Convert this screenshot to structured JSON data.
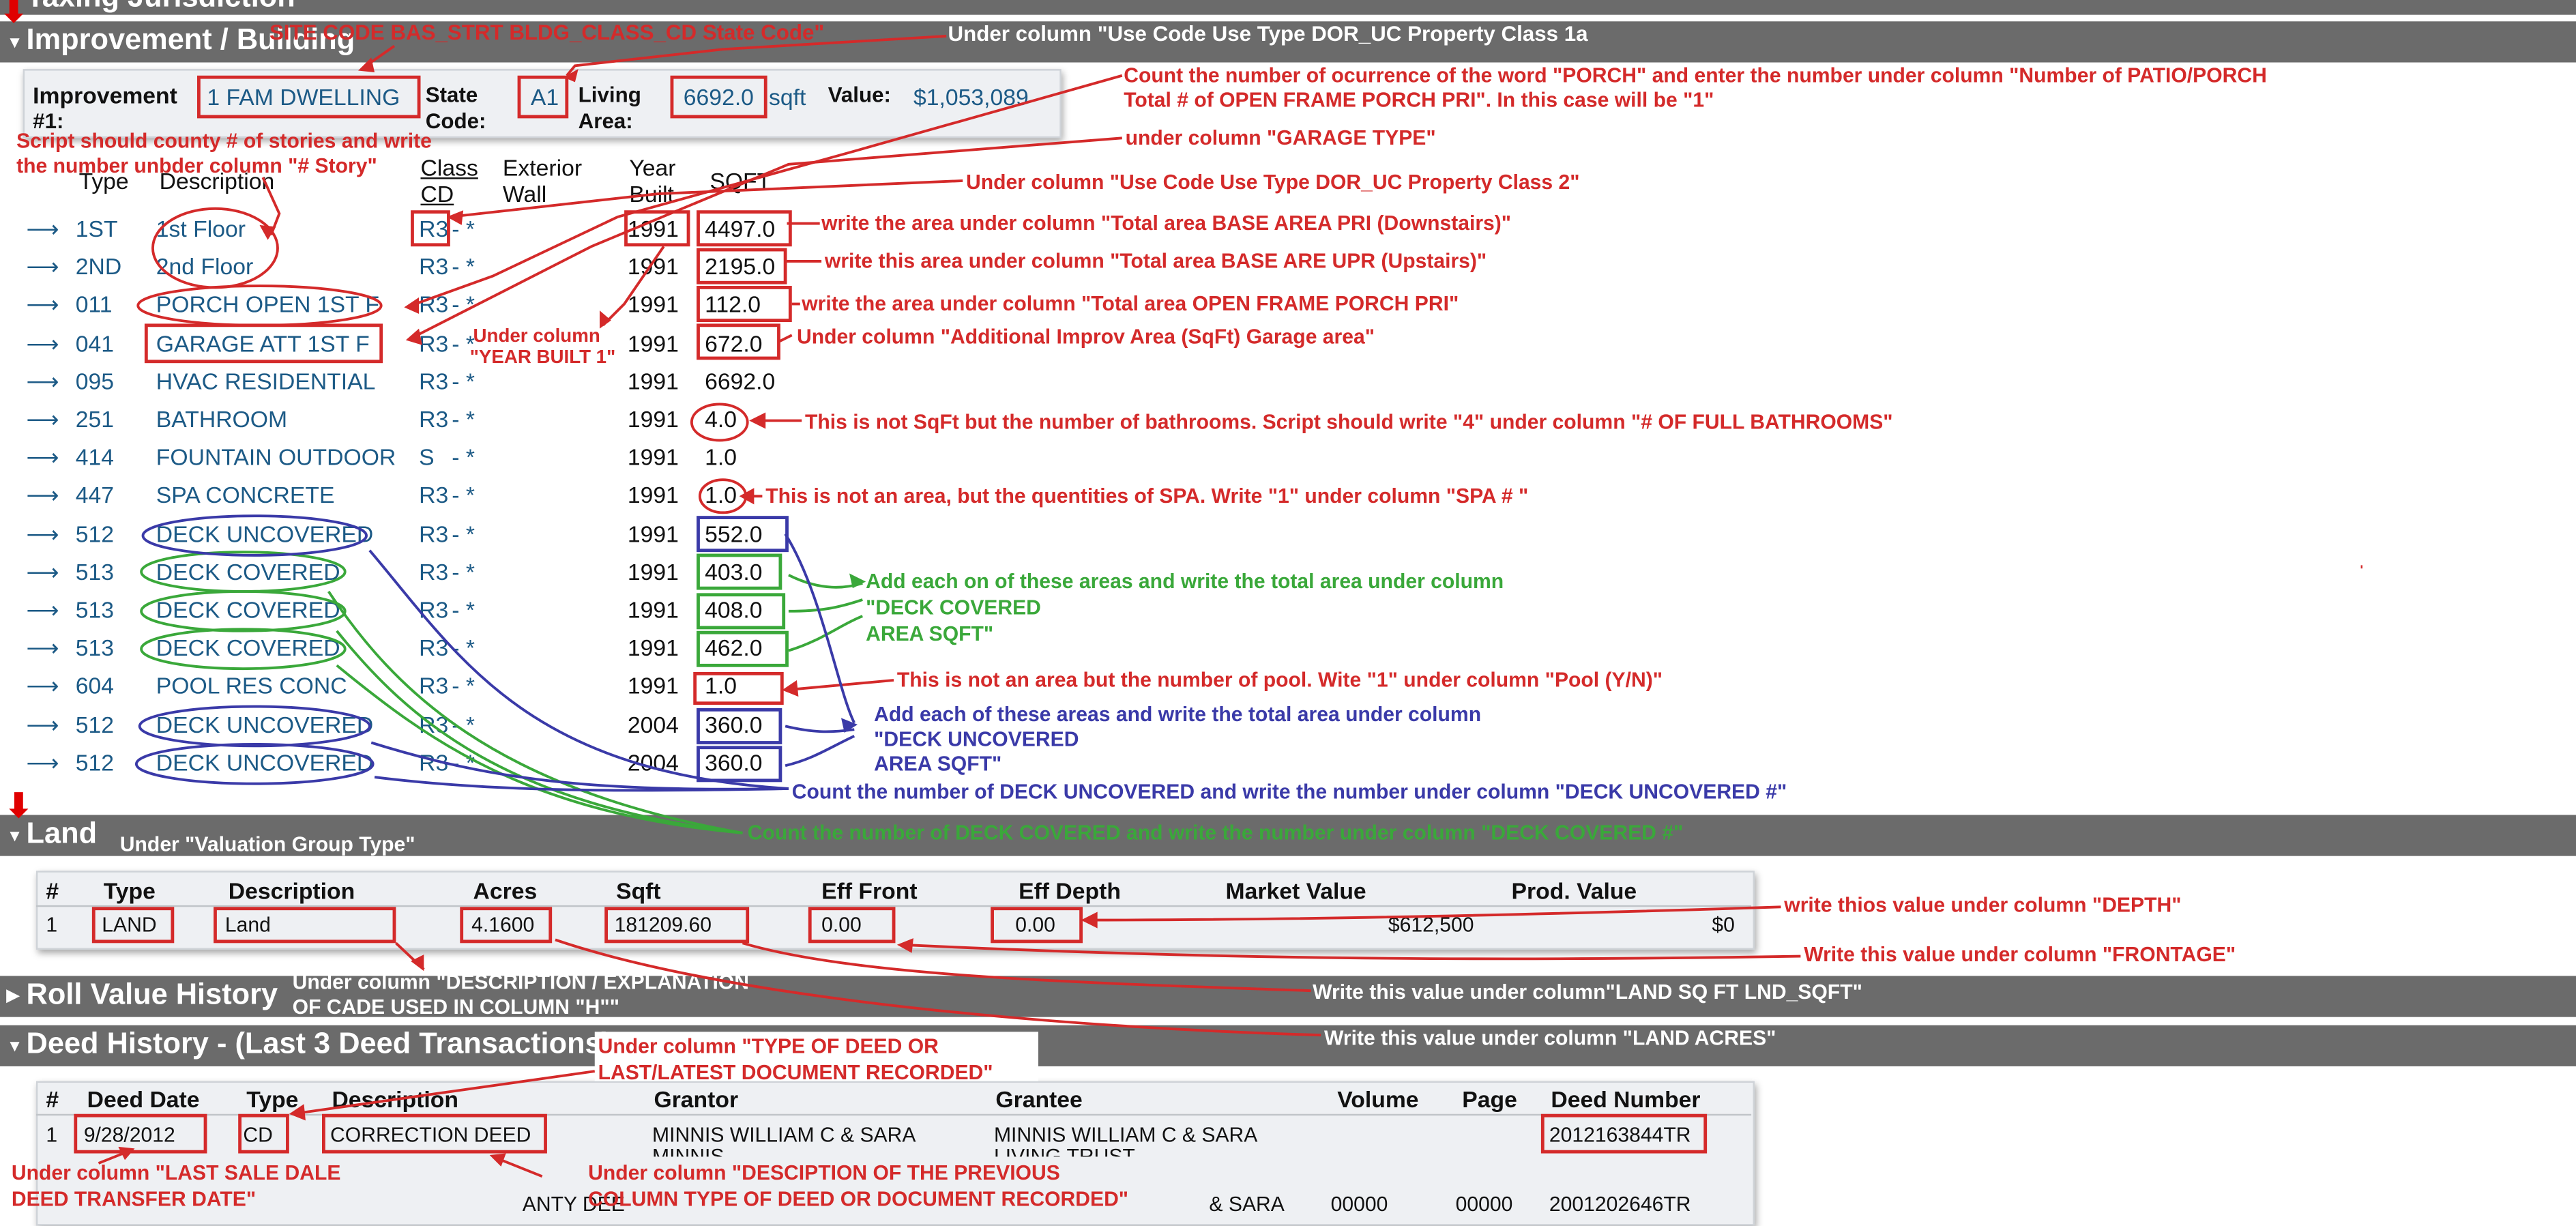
{
  "sections": {
    "taxing": "Taxing Jurisdiction",
    "improvement": "Improvement / Building",
    "land": "Land",
    "roll": "Roll Value History",
    "deed": "Deed History - (Last 3 Deed Transactions)"
  },
  "improvement": {
    "label_improvement": "Improvement",
    "label_num": "#1:",
    "type_value": "1 FAM DWELLING",
    "label_state": "State",
    "label_code": "Code:",
    "state_code": "A1",
    "label_living": "Living",
    "label_area": "Area:",
    "living_area": "6692.0",
    "sqft_unit": "sqft",
    "label_value": "Value:",
    "value": "$1,053,089"
  },
  "subareas": {
    "headers": {
      "type": "Type",
      "description": "Description",
      "class1": "Class",
      "class2": "CD",
      "ext1": "Exterior",
      "ext2": "Wall",
      "yb1": "Year",
      "yb2": "Built",
      "sqft": "SQFT"
    },
    "arrow": "⟶",
    "rows": [
      {
        "type": "1ST",
        "description": "1st Floor",
        "class_cd": "R3",
        "ext": "- *",
        "year": "1991",
        "sqft": "4497.0"
      },
      {
        "type": "2ND",
        "description": "2nd Floor",
        "class_cd": "R3",
        "ext": "- *",
        "year": "1991",
        "sqft": "2195.0"
      },
      {
        "type": "011",
        "description": "PORCH OPEN 1ST F",
        "class_cd": "R3",
        "ext": "- *",
        "year": "1991",
        "sqft": "112.0"
      },
      {
        "type": "041",
        "description": "GARAGE ATT 1ST F",
        "class_cd": "R3",
        "ext": "- *",
        "year": "1991",
        "sqft": "672.0"
      },
      {
        "type": "095",
        "description": "HVAC RESIDENTIAL",
        "class_cd": "R3",
        "ext": "- *",
        "year": "1991",
        "sqft": "6692.0"
      },
      {
        "type": "251",
        "description": "BATHROOM",
        "class_cd": "R3",
        "ext": "- *",
        "year": "1991",
        "sqft": "4.0"
      },
      {
        "type": "414",
        "description": "FOUNTAIN OUTDOOR",
        "class_cd": "S",
        "ext": "- *",
        "year": "1991",
        "sqft": "1.0"
      },
      {
        "type": "447",
        "description": "SPA CONCRETE",
        "class_cd": "R3",
        "ext": "- *",
        "year": "1991",
        "sqft": "1.0"
      },
      {
        "type": "512",
        "description": "DECK UNCOVERED",
        "class_cd": "R3",
        "ext": "- *",
        "year": "1991",
        "sqft": "552.0"
      },
      {
        "type": "513",
        "description": "DECK COVERED",
        "class_cd": "R3",
        "ext": "- *",
        "year": "1991",
        "sqft": "403.0"
      },
      {
        "type": "513",
        "description": "DECK COVERED",
        "class_cd": "R3",
        "ext": "- *",
        "year": "1991",
        "sqft": "408.0"
      },
      {
        "type": "513",
        "description": "DECK COVERED",
        "class_cd": "R3",
        "ext": "- *",
        "year": "1991",
        "sqft": "462.0"
      },
      {
        "type": "604",
        "description": "POOL RES CONC",
        "class_cd": "R3",
        "ext": "- *",
        "year": "1991",
        "sqft": "1.0"
      },
      {
        "type": "512",
        "description": "DECK UNCOVERED",
        "class_cd": "R3",
        "ext": "- *",
        "year": "2004",
        "sqft": "360.0"
      },
      {
        "type": "512",
        "description": "DECK UNCOVERED",
        "class_cd": "R3",
        "ext": "- *",
        "year": "2004",
        "sqft": "360.0"
      }
    ]
  },
  "land": {
    "headers": [
      "#",
      "Type",
      "Description",
      "Acres",
      "Sqft",
      "Eff Front",
      "Eff Depth",
      "Market Value",
      "Prod. Value"
    ],
    "row": [
      "1",
      "LAND",
      "Land",
      "4.1600",
      "181209.60",
      "0.00",
      "0.00",
      "$612,500",
      "$0"
    ]
  },
  "deed": {
    "headers": [
      "#",
      "Deed Date",
      "Type",
      "Description",
      "Grantor",
      "Grantee",
      "Volume",
      "Page",
      "Deed Number"
    ],
    "row1": [
      "1",
      "9/28/2012",
      "CD",
      "CORRECTION DEED",
      "MINNIS WILLIAM C & SARA",
      "MINNIS WILLIAM C & SARA",
      "",
      "",
      "2012163844TR"
    ],
    "row1_sub": [
      "MINNIS",
      "LIVING TRUST"
    ],
    "row2": [
      "ANTY DEE",
      "& SARA",
      "00000",
      "00000",
      "2001202646TR"
    ]
  },
  "annotations": {
    "a1": "SITE CODE BAS_STRT BLDG_CLASS_CD State Code\"",
    "a2": "Under column \"Use Code  Use Type  DOR_UC Property Class 1a",
    "a3": "Count the number of ocurrence of the word \"PORCH\" and enter the number under column \"Number of PATIO/PORCH",
    "a3b": "Total # of OPEN FRAME PORCH PRI\". In this case will be \"1\"",
    "a4": "under column \"GARAGE TYPE\"",
    "a5": "Script should county # of stories and write",
    "a5b": "the number unbder column \"# Story\"",
    "a6": "Under column \"Use Code Use Type DOR_UC Property Class 2\"",
    "a7": "write the area under column \"Total area BASE AREA PRI (Downstairs)\"",
    "a8": "write this area under column \"Total area BASE ARE UPR (Upstairs)\"",
    "a9": "write the area under column \"Total area OPEN FRAME PORCH PRI\"",
    "a10": "Under column \"Additional Improv Area (SqFt)   Garage area\"",
    "a11": "Under column",
    "a11b": "\"YEAR BUILT 1\"",
    "a12": "This is not SqFt but the number of bathrooms. Script should write \"4\" under column \"# OF FULL BATHROOMS\"",
    "a13": "This is not an area, but the quentities of SPA. Write \"1\" under column \"SPA # \"",
    "a14": "Add each on of these areas and write the total area under column",
    "a14b": "\"DECK COVERED",
    "a14c": "AREA SQFT\"",
    "a15": "This is not an area but the number of pool. Wite \"1\" under column \"Pool (Y/N)\"",
    "a16": "Add each of these areas and write the total area under column",
    "a16b": "\"DECK UNCOVERED",
    "a16c": "AREA SQFT\"",
    "a17": "Count the number of DECK UNCOVERED and write the number under column \"DECK UNCOVERED #\"",
    "a18": "Count the number of DECK COVERED and write the number under column \"DECK COVERED #\"",
    "a19": "Under \"Valuation Group Type\"",
    "a20": "write thios value under column \"DEPTH\"",
    "a21": "Write this value under column \"FRONTAGE\"",
    "a22": "Under column \"DESCRIPTION / EXPLANATION",
    "a22b": "OF CADE USED IN COLUMN \"H\"\"",
    "a23": "Write this value under column\"LAND SQ FT LND_SQFT\"",
    "a24": "Write this value under column \"LAND ACRES\"",
    "a25": "Under column \"TYPE OF DEED OR",
    "a25b": "LAST/LATEST DOCUMENT RECORDED\"",
    "a26": "Under column \"LAST SALE DALE",
    "a26b": "DEED TRANSFER DATE\"",
    "a27": "Under column \"DESCIPTION  OF THE PREVIOUS",
    "a27b": "COLUMN TYPE OF DEED OR DOCUMENT RECORDED\""
  }
}
